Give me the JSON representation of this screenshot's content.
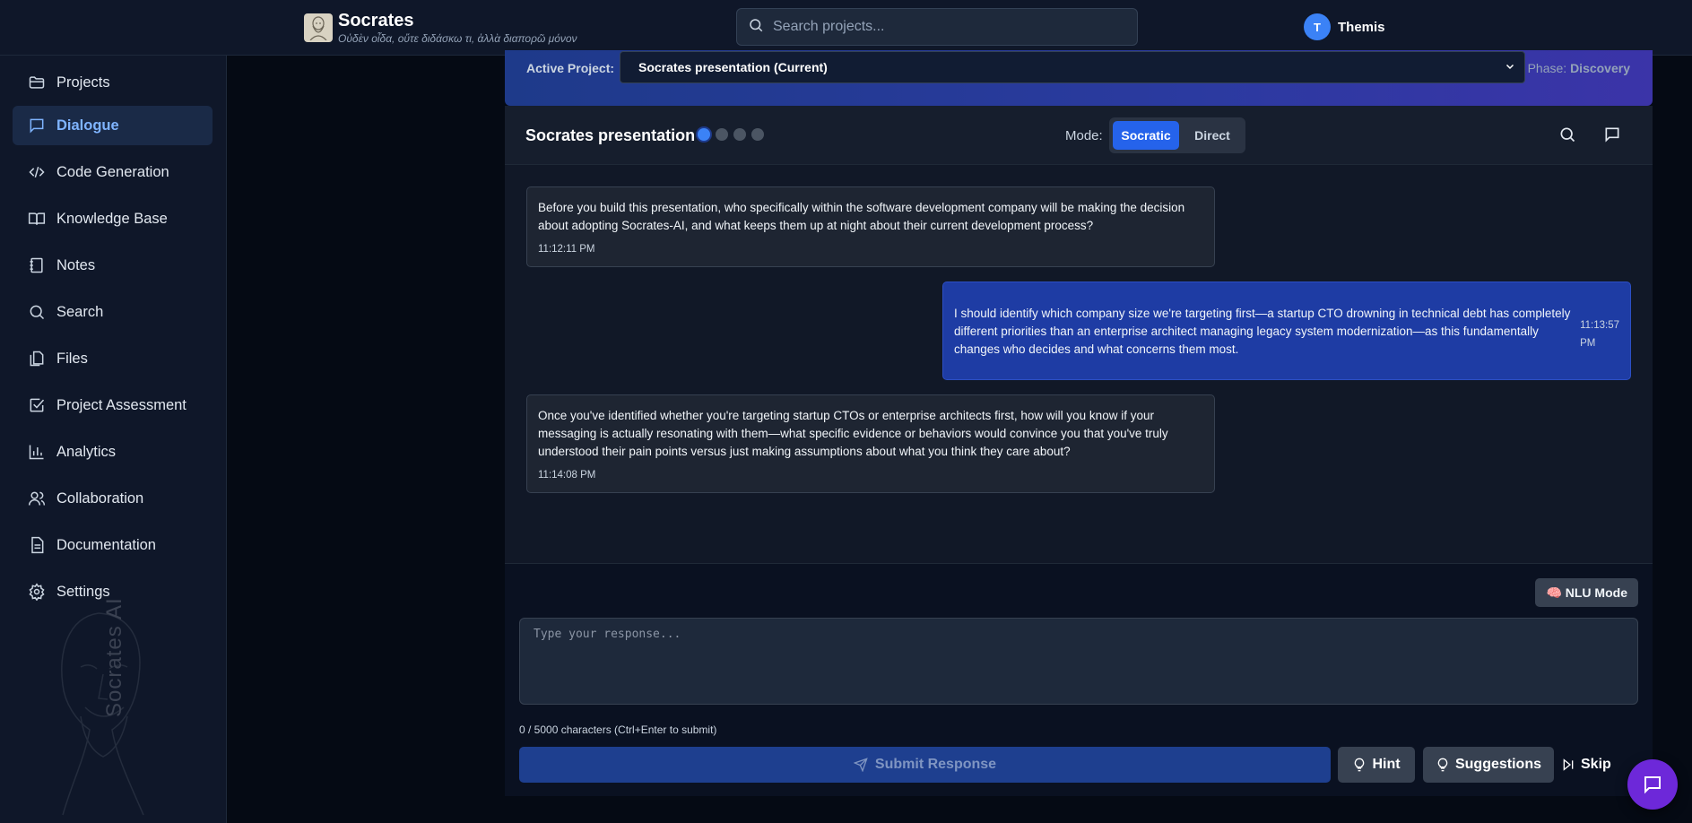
{
  "header": {
    "title": "Socrates",
    "subtitle": "Οὐδὲν οἶδα, οὔτε διδάσκω τι, ἀλλὰ διαπορῶ μόνον",
    "search_placeholder": "Search projects...",
    "user_initial": "T",
    "user_name": "Themis"
  },
  "sidebar": {
    "items": [
      {
        "label": "Projects",
        "icon": "folder-icon"
      },
      {
        "label": "Dialogue",
        "icon": "chat-icon",
        "active": true
      },
      {
        "label": "Code Generation",
        "icon": "code-icon"
      },
      {
        "label": "Knowledge Base",
        "icon": "book-icon"
      },
      {
        "label": "Notes",
        "icon": "notebook-icon"
      },
      {
        "label": "Search",
        "icon": "search-icon"
      },
      {
        "label": "Files",
        "icon": "files-icon"
      },
      {
        "label": "Project Assessment",
        "icon": "checkbox-icon"
      },
      {
        "label": "Analytics",
        "icon": "bar-chart-icon"
      },
      {
        "label": "Collaboration",
        "icon": "users-icon"
      },
      {
        "label": "Documentation",
        "icon": "document-icon"
      },
      {
        "label": "Settings",
        "icon": "gear-icon"
      }
    ],
    "watermark": "Socrates AI"
  },
  "project_bar": {
    "label": "Active Project:",
    "selected": "Socrates presentation (Current)",
    "phase_label": "Phase:",
    "phase_value": "Discovery"
  },
  "chat": {
    "title": "Socrates presentation",
    "mode_label": "Mode:",
    "mode_options": [
      "Socratic",
      "Direct"
    ],
    "mode_selected": "Socratic",
    "messages": [
      {
        "role": "ai",
        "text": "Before you build this presentation, who specifically within the software development company will be making the decision about adopting Socrates-AI, and what keeps them up at night about their current development process?",
        "time": "11:12:11 PM"
      },
      {
        "role": "user",
        "text": "I should identify which company size we're targeting first—a startup CTO drowning in technical debt has completely different priorities than an enterprise architect managing legacy system modernization—as this fundamentally changes who decides and what concerns them most.",
        "time": "11:13:57 PM"
      },
      {
        "role": "ai",
        "text": "Once you've identified whether you're targeting startup CTOs or enterprise architects first, how will you know if your messaging is actually resonating with them—what specific evidence or behaviors would convince you that you've truly understood their pain points versus just making assumptions about what you think they care about?",
        "time": "11:14:08 PM"
      }
    ]
  },
  "input": {
    "nlu_label": "🧠 NLU Mode",
    "placeholder": "Type your response...",
    "char_count": "0 / 5000 characters (Ctrl+Enter to submit)",
    "submit_label": "Submit Response",
    "hint_label": "Hint",
    "suggestions_label": "Suggestions",
    "skip_label": "Skip"
  }
}
